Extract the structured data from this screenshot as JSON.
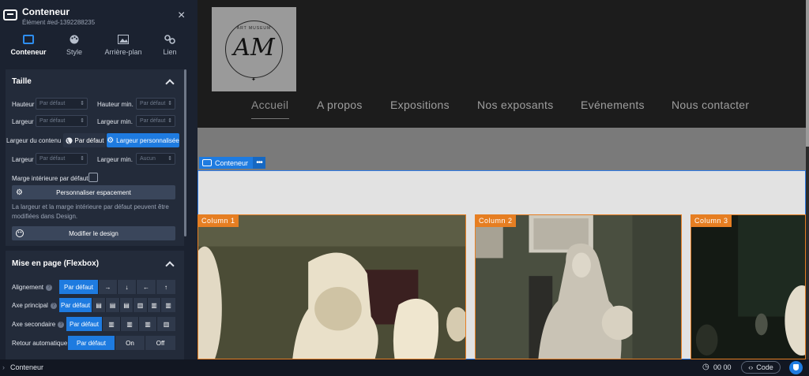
{
  "panel": {
    "title": "Conteneur",
    "element_id": "Élément #ed-1392288235",
    "close_icon": "×",
    "tabs": [
      {
        "label": "Conteneur",
        "icon": "container-icon",
        "active": true
      },
      {
        "label": "Style",
        "icon": "palette-icon",
        "active": false
      },
      {
        "label": "Arrière-plan",
        "icon": "image-icon",
        "active": false
      },
      {
        "label": "Lien",
        "icon": "link-icon",
        "active": false
      }
    ],
    "size_section": {
      "title": "Taille",
      "height_label": "Hauteur",
      "height_placeholder": "Par défaut",
      "min_height_label": "Hauteur min.",
      "min_height_placeholder": "Par défaut",
      "width_label": "Largeur",
      "width_placeholder": "Par défaut",
      "min_width_label": "Largeur min.",
      "min_width_placeholder": "Par défaut",
      "content_width_label": "Largeur du contenu",
      "content_width_default": "Par défaut",
      "content_width_custom": "Largeur personnalisée",
      "width2_label": "Largeur",
      "width2_placeholder": "Par défaut",
      "min_width2_label": "Largeur min.",
      "min_width2_placeholder": "Aucun",
      "default_padding_label": "Marge intérieure par défaut",
      "customize_spacing_button": "Personnaliser espacement",
      "note": "La largeur et la marge intérieure par défaut peuvent être modifiées dans Design.",
      "edit_design_button": "Modifier le design"
    },
    "layout_section": {
      "title": "Mise en page (Flexbox)",
      "alignment_label": "Alignement",
      "alignment_default": "Par défaut",
      "alignment_options": [
        "→",
        "↓",
        "←",
        "↑"
      ],
      "main_axis_label": "Axe principal",
      "main_axis_default": "Par défaut",
      "cross_axis_label": "Axe secondaire",
      "cross_axis_default": "Par défaut",
      "wrap_label": "Retour automatique",
      "wrap_default": "Par défaut",
      "wrap_on": "On",
      "wrap_off": "Off"
    }
  },
  "bottombar": {
    "chevron": "›",
    "breadcrumb": "Conteneur",
    "clock_icon": "◷",
    "timer": "00 00",
    "code_label": "Code",
    "code_icon": "‹›"
  },
  "preview": {
    "logo": {
      "text": "AM",
      "top_text": "ART MUSEUM"
    },
    "nav": [
      "Accueil",
      "A propos",
      "Expositions",
      "Nos exposants",
      "Evénements",
      "Nous contacter"
    ],
    "container_tag": "Conteneur",
    "container_more": "•••",
    "columns": [
      "Column 1",
      "Column 2",
      "Column 3"
    ]
  },
  "colors": {
    "accent": "#1e7be0",
    "column_outline": "#e67e22",
    "panel_bg": "#1b2230"
  }
}
